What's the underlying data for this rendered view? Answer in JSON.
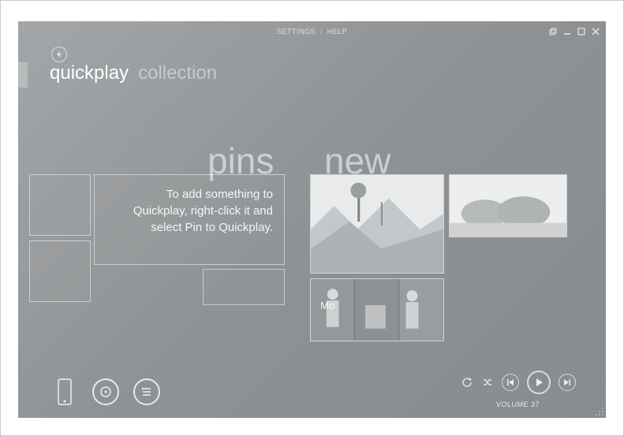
{
  "topbar": {
    "settings_label": "SETTINGS",
    "help_label": "HELP"
  },
  "nav": {
    "active": "quickplay",
    "inactive": "collection"
  },
  "sections": {
    "pins_title": "pins",
    "new_title": "new",
    "pins_hint": "To add something to Quickplay, right-click it and select Pin to Quickplay."
  },
  "new_items": {
    "bottom_label": "Mo"
  },
  "footer": {
    "volume_label": "VOLUME 37"
  }
}
